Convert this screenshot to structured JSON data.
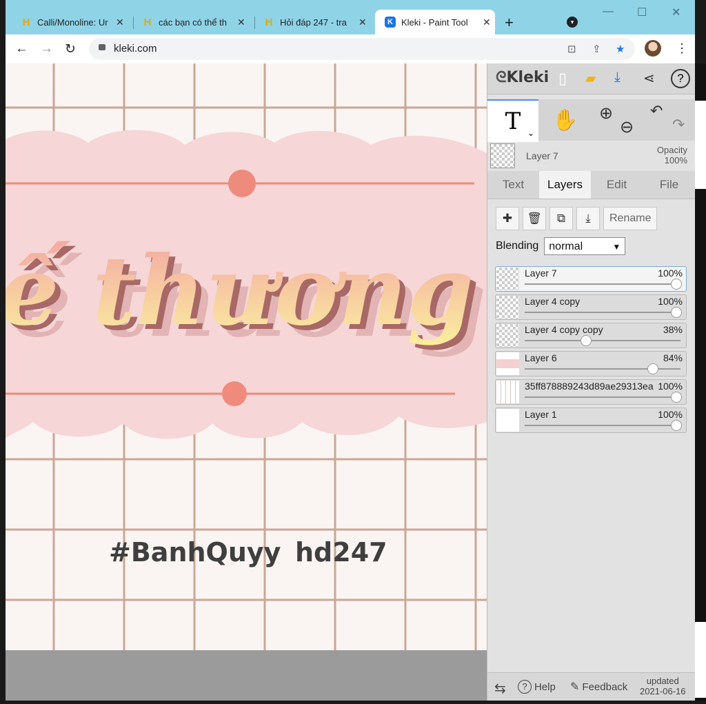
{
  "tabs": [
    {
      "title": "Calli/Monoline: Ur",
      "favicon": "hoidap-icon"
    },
    {
      "title": "các bạn có thể th",
      "favicon": "hoidap-icon"
    },
    {
      "title": "Hỏi đáp 247 - tra",
      "favicon": "hoidap-icon"
    },
    {
      "title": "Kleki - Paint Tool",
      "favicon": "kleki-icon",
      "active": true
    }
  ],
  "address": {
    "url": "kleki.com"
  },
  "canvas": {
    "artwork_text": "ế thương",
    "watermark_left": "#BanhQuyy",
    "watermark_right": "hd247"
  },
  "panel": {
    "logo": "Kleki",
    "current_layer": {
      "name": "Layer 7",
      "opacity_label": "Opacity",
      "opacity_value": "100%"
    },
    "tabs": [
      "Text",
      "Layers",
      "Edit",
      "File"
    ],
    "active_tab": "Layers",
    "rename_label": "Rename",
    "blending_label": "Blending",
    "blending_value": "normal",
    "layers": [
      {
        "name": "Layer 7",
        "opacity": "100%",
        "level": 1.0,
        "active": true
      },
      {
        "name": "Layer 4 copy",
        "opacity": "100%",
        "level": 1.0
      },
      {
        "name": "Layer 4 copy copy",
        "opacity": "38%",
        "level": 0.38
      },
      {
        "name": "Layer 6",
        "opacity": "84%",
        "level": 0.84
      },
      {
        "name": "35ff878889243d89ae29313ea",
        "opacity": "100%",
        "level": 1.0
      },
      {
        "name": "Layer 1",
        "opacity": "100%",
        "level": 1.0
      }
    ],
    "footer": {
      "help": "Help",
      "feedback": "Feedback",
      "updated_label": "updated",
      "updated_date": "2021-06-16"
    }
  },
  "colors": {
    "tabstrip": "#8fd3e7",
    "accent": "#1a73e8",
    "cloud": "#f6d6d7",
    "line": "#ee8a78"
  }
}
